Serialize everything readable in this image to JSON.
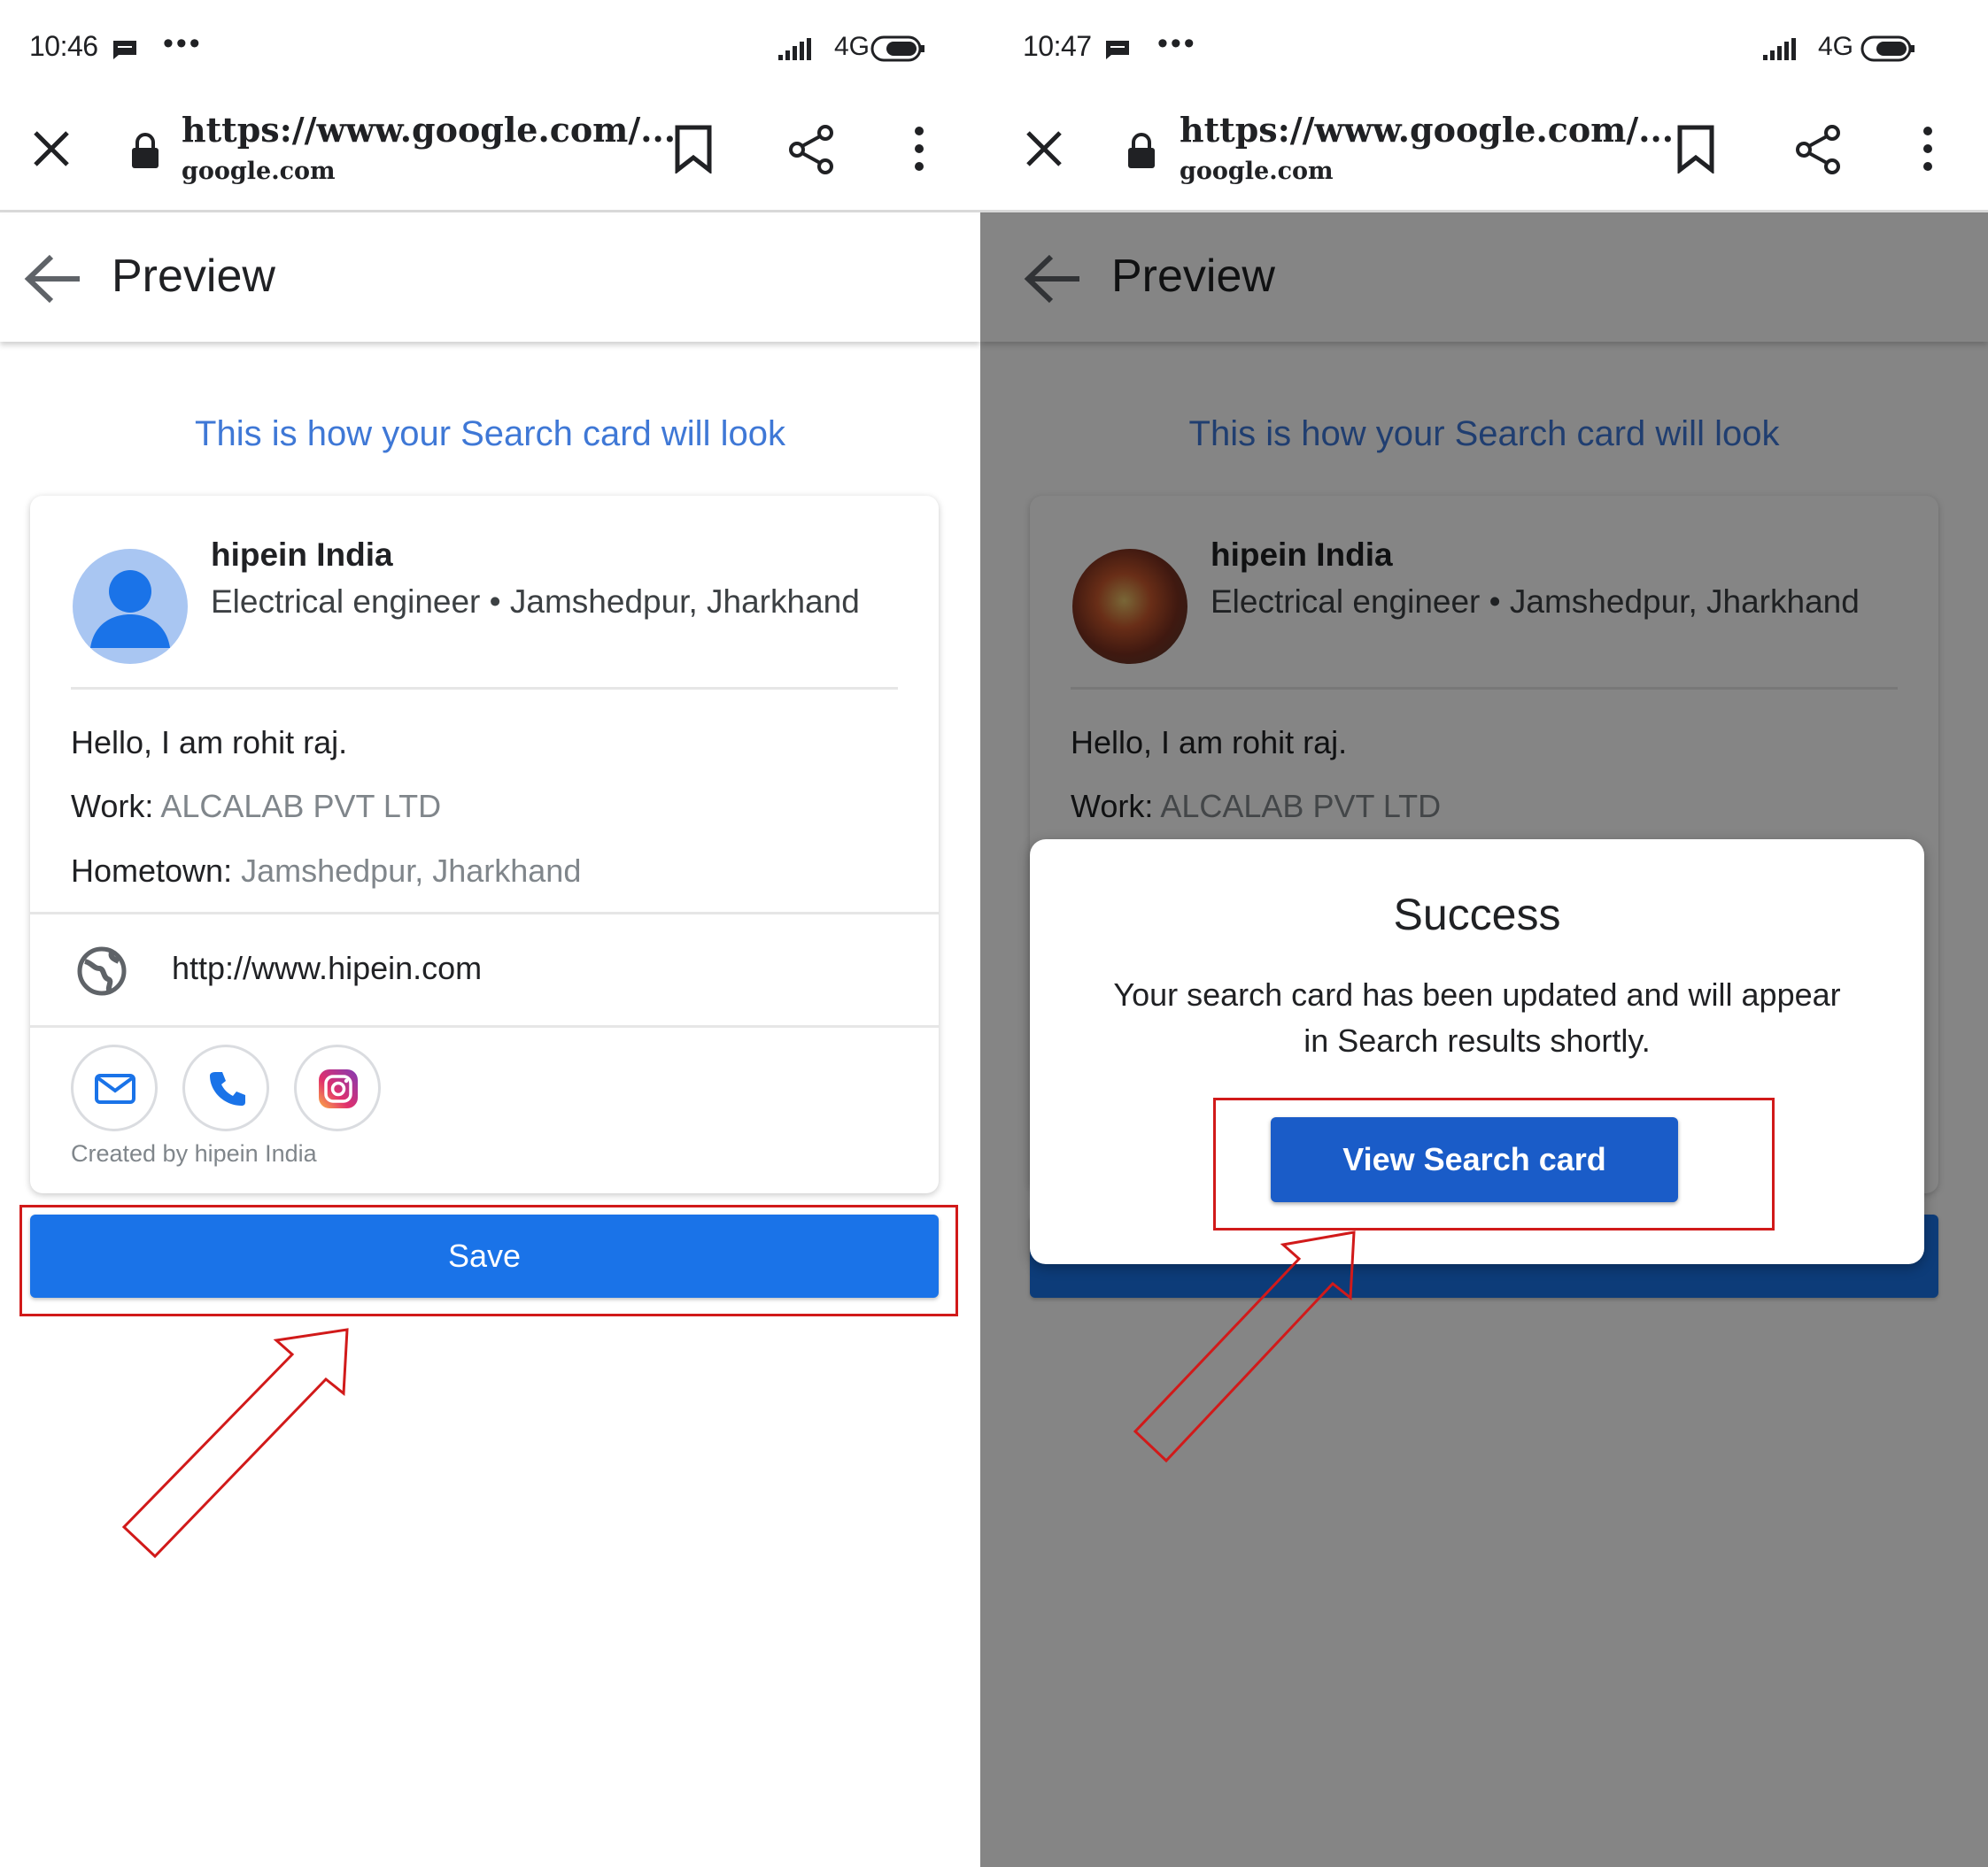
{
  "left": {
    "status": {
      "time": "10:46",
      "dots": "•••",
      "network": "4G"
    },
    "browser": {
      "url": "https://www.google.com/...",
      "domain": "google.com"
    },
    "app_bar": {
      "title": "Preview"
    },
    "heading": "This is how your Search card will look",
    "card": {
      "name": "hipein India",
      "subtitle": "Electrical engineer • Jamshedpur, Jharkhand",
      "intro": "Hello, I am rohit raj.",
      "work_label": "Work:",
      "work_value": "ALCALAB PVT LTD",
      "hometown_label": "Hometown:",
      "hometown_value": "Jamshedpur, Jharkhand",
      "website": "http://www.hipein.com",
      "created_by": "Created by hipein India"
    },
    "save_label": "Save"
  },
  "right": {
    "status": {
      "time": "10:47",
      "dots": "•••",
      "network": "4G"
    },
    "browser": {
      "url": "https://www.google.com/...",
      "domain": "google.com"
    },
    "app_bar": {
      "title": "Preview"
    },
    "heading": "This is how your Search card will look",
    "card": {
      "name": "hipein India",
      "subtitle": "Electrical engineer • Jamshedpur, Jharkhand",
      "intro": "Hello, I am rohit raj.",
      "work_label": "Work:",
      "work_value": "ALCALAB PVT LTD"
    },
    "dialog": {
      "title": "Success",
      "body": "Your search card has been updated and will appear in Search results shortly.",
      "button_label": "View Search card"
    }
  },
  "colors": {
    "primary_button": "#1a73e8",
    "dialog_button": "#1a5cc8",
    "heading_blue": "#3f78d6",
    "annotation_red": "#d11a1a",
    "scrim": "rgba(0,0,0,0.48)"
  },
  "icons": [
    "close-icon",
    "lock-icon",
    "bookmark-icon",
    "share-icon",
    "more-icon",
    "back-icon",
    "globe-icon",
    "mail-icon",
    "phone-icon",
    "instagram-icon",
    "message-icon",
    "signal-icon",
    "battery-icon"
  ]
}
